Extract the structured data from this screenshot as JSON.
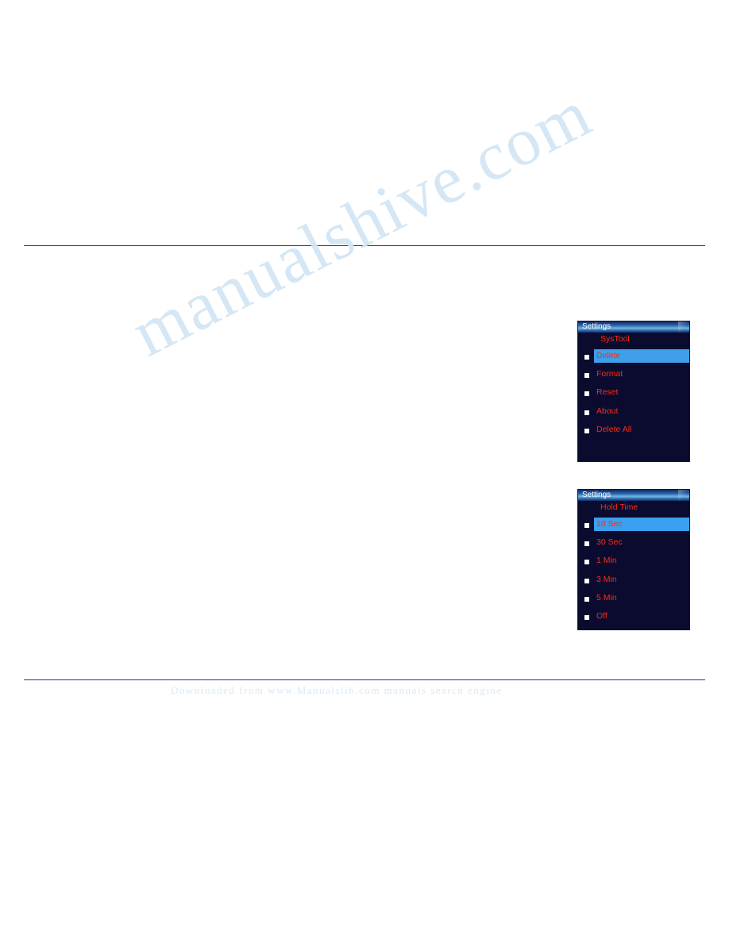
{
  "page": {
    "watermark_main": "manualshive.com",
    "watermark_footer": "Downloaded from www.Manualslib.com manuals search engine"
  },
  "screens": [
    {
      "name": "settings-systool",
      "title": "Settings",
      "header": "SysTool",
      "items": [
        {
          "label": "Delete",
          "selected": true,
          "bullet": true
        },
        {
          "label": "Format",
          "selected": false,
          "bullet": true
        },
        {
          "label": "Reset",
          "selected": false,
          "bullet": true
        },
        {
          "label": "About",
          "selected": false,
          "bullet": true
        },
        {
          "label": "Delete All",
          "selected": false,
          "bullet": true
        }
      ]
    },
    {
      "name": "settings-hold-time",
      "title": "Settings",
      "header": "Hold Time",
      "items": [
        {
          "label": "10 Sec",
          "selected": true,
          "bullet": true
        },
        {
          "label": "30 Sec",
          "selected": false,
          "bullet": true
        },
        {
          "label": "1 Min",
          "selected": false,
          "bullet": true
        },
        {
          "label": "3 Min",
          "selected": false,
          "bullet": true
        },
        {
          "label": "5 Min",
          "selected": false,
          "bullet": true
        },
        {
          "label": "Off",
          "selected": false,
          "bullet": true
        }
      ]
    }
  ]
}
